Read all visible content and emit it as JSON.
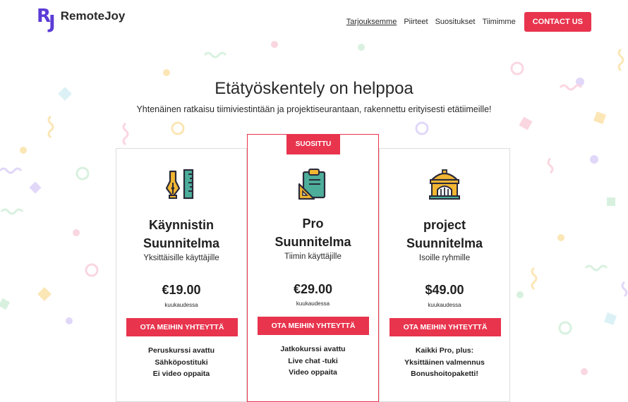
{
  "brand": {
    "mark": "RJ",
    "name": "RemoteJoy"
  },
  "nav": {
    "links": [
      "Tarjouksemme",
      "Piirteet",
      "Suositukset",
      "Tiimimme"
    ],
    "contact": "CONTACT US"
  },
  "hero": {
    "title": "Etätyöskentely on helppoa",
    "subtitle": "Yhtenäinen ratkaisu tiimiviestintään ja projektiseurantaan, rakennettu erityisesti etätiimeille!"
  },
  "plans": [
    {
      "icon": "pen-and-ruler-icon",
      "name_line1": "Käynnistin",
      "name_line2": "Suunnitelma",
      "audience": "Yksittäisille käyttäjille",
      "price": "€19.00",
      "period": "kuukaudessa",
      "cta": "OTA MEIHIN YHTEYTTÄ",
      "features": [
        "Peruskurssi avattu",
        "Sähköpostituki",
        "Ei video oppaita"
      ]
    },
    {
      "badge": "SUOSITTU",
      "icon": "clipboard-set-square-icon",
      "name_line1": "Pro",
      "name_line2": "Suunnitelma",
      "audience": "Tiimin käyttäjille",
      "price": "€29.00",
      "period": "kuukaudessa",
      "cta": "OTA MEIHIN YHTEYTTÄ",
      "features": [
        "Jatkokurssi avattu",
        "Live chat -tuki",
        "Video oppaita"
      ]
    },
    {
      "icon": "building-icon",
      "name_line1": "project",
      "name_line2": "Suunnitelma",
      "audience": "Isoille ryhmille",
      "price": "$49.00",
      "period": "kuukaudessa",
      "cta": "OTA MEIHIN YHTEYTTÄ",
      "features": [
        "Kaikki Pro, plus:",
        "Yksittäinen valmennus",
        "Bonushoitopaketti!"
      ]
    }
  ],
  "colors": {
    "accent": "#e8344d",
    "brand": "#5b3bd6",
    "icon_gold": "#f2b632",
    "icon_green": "#4cae9a",
    "icon_outline": "#2a2a3a"
  }
}
